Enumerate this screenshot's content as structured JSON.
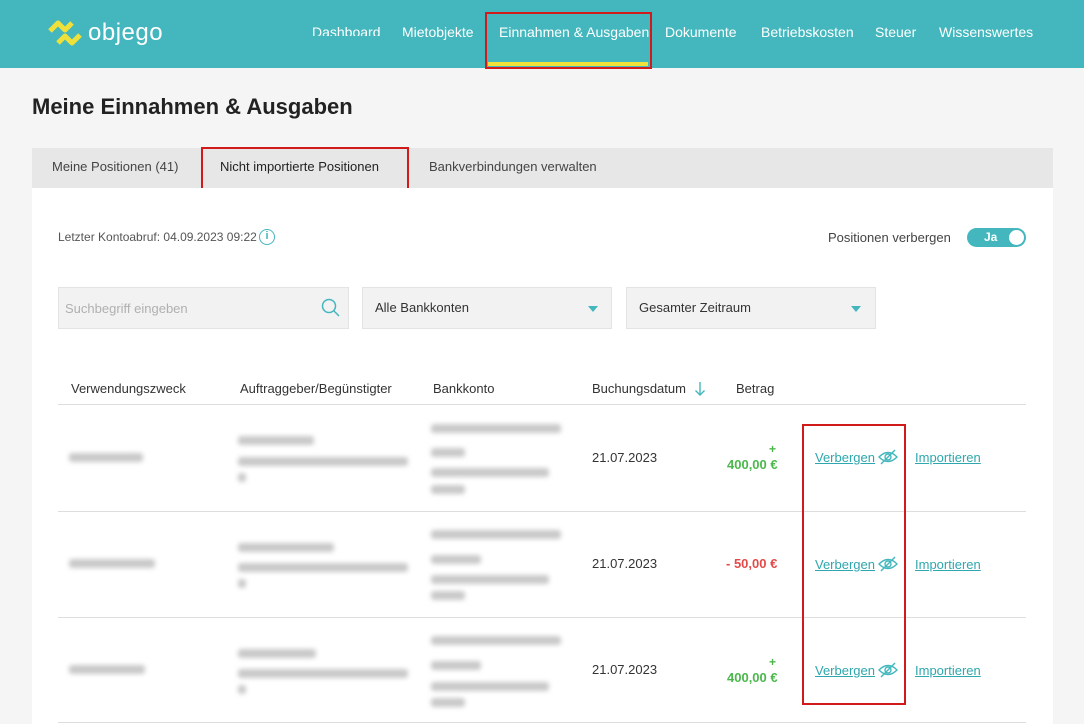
{
  "brand": {
    "name": "objego",
    "logo_color": "#f0e13a"
  },
  "nav": {
    "dashboard": "Dashboard",
    "mietobjekte": "Mietobjekte",
    "einnahmen": "Einnahmen & Ausgaben",
    "dokumente": "Dokumente",
    "betriebskosten": "Betriebskosten",
    "steuer": "Steuer",
    "wissenswertes": "Wissenswertes"
  },
  "page": {
    "title": "Meine Einnahmen & Ausgaben"
  },
  "tabs": {
    "meine": "Meine Positionen (41)",
    "nicht_importiert": "Nicht importierte Positionen",
    "bank": "Bankverbindungen verwalten"
  },
  "status": {
    "last_fetch": "Letzter Kontoabruf: 04.09.2023 09:22"
  },
  "hide_toggle": {
    "label": "Positionen verbergen",
    "state": "Ja"
  },
  "filters": {
    "search_placeholder": "Suchbegriff eingeben",
    "account": "Alle Bankkonten",
    "period": "Gesamter Zeitraum"
  },
  "table": {
    "headers": {
      "purpose": "Verwendungszweck",
      "party": "Auftraggeber/Begünstigter",
      "account": "Bankkonto",
      "date": "Buchungsdatum",
      "amount": "Betrag"
    },
    "rows": [
      {
        "date": "21.07.2023",
        "sign": "+",
        "amount": "400,00 €",
        "hide_label": "Verbergen",
        "import_label": "Importieren"
      },
      {
        "date": "21.07.2023",
        "sign": "",
        "amount": "- 50,00 €",
        "hide_label": "Verbergen",
        "import_label": "Importieren"
      },
      {
        "date": "21.07.2023",
        "sign": "+",
        "amount": "400,00 €",
        "hide_label": "Verbergen",
        "import_label": "Importieren"
      }
    ]
  },
  "colors": {
    "accent": "#43b7bd",
    "positive": "#4bb84b",
    "negative": "#e34a4a",
    "highlight": "#d11b1b"
  }
}
